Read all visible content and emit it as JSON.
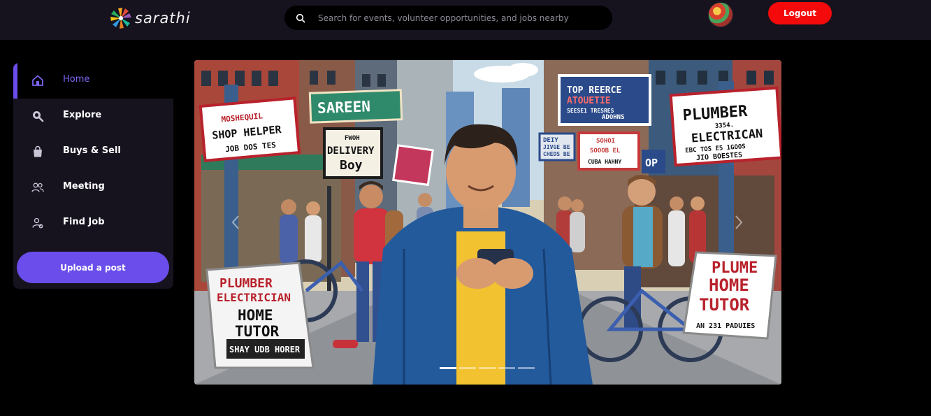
{
  "header": {
    "logo_text": "sarathi",
    "search_placeholder": "Search for events, volunteer opportunities, and jobs nearby",
    "logout_label": "Logout"
  },
  "sidebar": {
    "items": [
      {
        "label": "Home",
        "icon": "home-icon",
        "active": true
      },
      {
        "label": "Explore",
        "icon": "search-icon"
      },
      {
        "label": "Buys & Sell",
        "icon": "shopping-bag-icon"
      },
      {
        "label": "Meeting",
        "icon": "people-icon"
      },
      {
        "label": "Find Job",
        "icon": "user-check-icon"
      }
    ],
    "upload_label": "Upload a post"
  },
  "carousel": {
    "slide_count": 5,
    "active_slide": 1,
    "signs": {
      "left_top": [
        "MOSHEQUIL",
        "SHOP HELPER",
        "JOB DOS TES"
      ],
      "green": [
        "SAREEN"
      ],
      "delivery": [
        "FWOH",
        "DELIVERY",
        "Boy"
      ],
      "blue": [
        "TOP REERCE",
        "ATOUETIE",
        "SEESE1  TRESRES",
        "ADOHNS"
      ],
      "small_red": [
        "SOHOI",
        "SOOOB EL",
        "CUBA HAHNY"
      ],
      "right_top": [
        "PLUMBER",
        "3354.",
        "ELECTRICAN",
        "EBC TOS E5 1GOOS",
        "JIO BOESTES"
      ],
      "left_bottom": [
        "PLUMBER",
        "ELECTRICIAN",
        "HOME",
        "TUTOR",
        "SHAY UDB HORER"
      ],
      "right_bottom": [
        "PLUME",
        "HOME",
        "TUTOR",
        "AN 231 PADUIES"
      ],
      "small_blue": [
        "DEIY",
        "JIVGE BE",
        "CHEDS BE"
      ],
      "op": [
        "OP"
      ]
    }
  },
  "colors": {
    "accent": "#6a4dea",
    "logout": "#f40a0a",
    "topbar": "#16131f",
    "background": "#000000"
  }
}
